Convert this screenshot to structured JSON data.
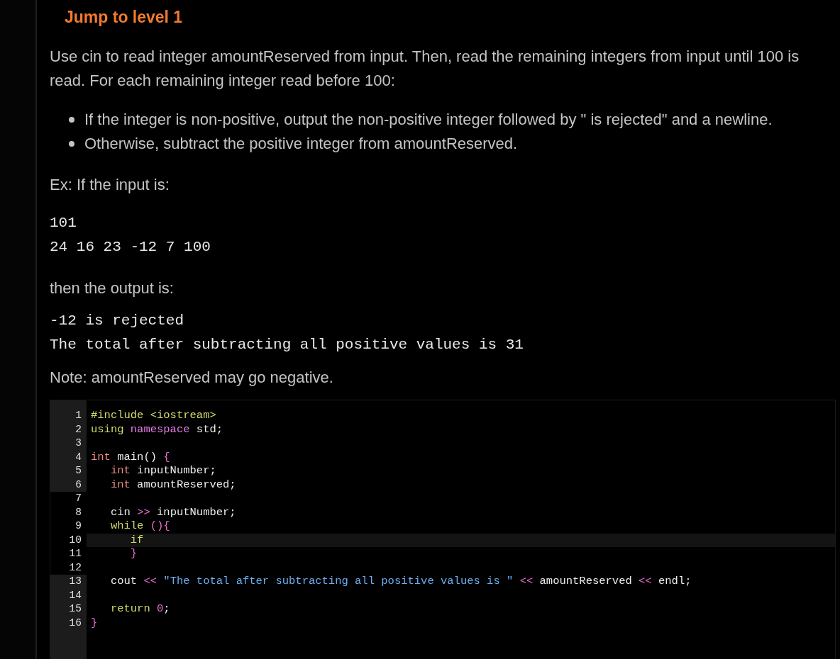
{
  "heading": "Jump to level 1",
  "intro": "Use cin to read integer amountReserved from input. Then, read the remaining integers from input until 100 is read. For each remaining integer read before 100:",
  "bullets": [
    "If the integer is non-positive, output the non-positive integer followed by \" is rejected\" and a newline.",
    "Otherwise, subtract the positive integer from amountReserved."
  ],
  "example_label": "Ex: If the input is:",
  "example_input": [
    "101",
    "24 16 23 -12 7 100"
  ],
  "output_label": "then the output is:",
  "example_output": [
    "-12 is rejected",
    "The total after subtracting all positive values is 31"
  ],
  "note": "Note: amountReserved may go negative.",
  "editor": {
    "lines": [
      {
        "number": "1",
        "editable": false,
        "active": false,
        "tokens": [
          {
            "text": "#include <iostream>",
            "kind": "keyword"
          }
        ]
      },
      {
        "number": "2",
        "editable": false,
        "active": false,
        "tokens": [
          {
            "text": "using ",
            "kind": "keyword"
          },
          {
            "text": "namespace",
            "kind": "namespace"
          },
          {
            "text": " std;",
            "kind": "plain"
          }
        ]
      },
      {
        "number": "3",
        "editable": false,
        "active": false
      },
      {
        "number": "4",
        "editable": false,
        "active": false,
        "tokens": [
          {
            "text": "int",
            "kind": "type"
          },
          {
            "text": " main() ",
            "kind": "plain"
          },
          {
            "text": "{",
            "kind": "punct"
          }
        ]
      },
      {
        "number": "5",
        "editable": false,
        "active": false,
        "tokens": [
          {
            "text": "   int",
            "kind": "type"
          },
          {
            "text": " inputNumber;",
            "kind": "plain"
          }
        ]
      },
      {
        "number": "6",
        "editable": false,
        "active": false,
        "tokens": [
          {
            "text": "   int",
            "kind": "type"
          },
          {
            "text": " amountReserved;",
            "kind": "plain"
          }
        ]
      },
      {
        "number": "7",
        "editable": true,
        "active": false
      },
      {
        "number": "8",
        "editable": true,
        "active": false,
        "tokens": [
          {
            "text": "   cin ",
            "kind": "plain"
          },
          {
            "text": ">>",
            "kind": "punct"
          },
          {
            "text": " inputNumber;",
            "kind": "plain"
          }
        ]
      },
      {
        "number": "9",
        "editable": true,
        "active": false,
        "tokens": [
          {
            "text": "   while ",
            "kind": "keyword"
          },
          {
            "text": "(){",
            "kind": "punct"
          }
        ]
      },
      {
        "number": "10",
        "editable": true,
        "active": true,
        "tokens": [
          {
            "text": "      if",
            "kind": "keyword"
          }
        ]
      },
      {
        "number": "11",
        "editable": true,
        "active": false,
        "tokens": [
          {
            "text": "      }",
            "kind": "punct"
          }
        ]
      },
      {
        "number": "12",
        "editable": true,
        "active": false
      },
      {
        "number": "13",
        "editable": false,
        "active": false,
        "tokens": [
          {
            "text": "   cout ",
            "kind": "plain"
          },
          {
            "text": "<< ",
            "kind": "punct"
          },
          {
            "text": "\"The total after subtracting all positive values is \" ",
            "kind": "string"
          },
          {
            "text": "<<",
            "kind": "punct"
          },
          {
            "text": " amountReserved ",
            "kind": "plain"
          },
          {
            "text": "<<",
            "kind": "punct"
          },
          {
            "text": " endl;",
            "kind": "plain"
          }
        ]
      },
      {
        "number": "14",
        "editable": false,
        "active": false
      },
      {
        "number": "15",
        "editable": false,
        "active": false,
        "tokens": [
          {
            "text": "   return ",
            "kind": "keyword"
          },
          {
            "text": "0",
            "kind": "number"
          },
          {
            "text": ";",
            "kind": "plain"
          }
        ]
      },
      {
        "number": "16",
        "editable": false,
        "active": false,
        "tokens": [
          {
            "text": "}",
            "kind": "punct"
          }
        ]
      }
    ]
  }
}
